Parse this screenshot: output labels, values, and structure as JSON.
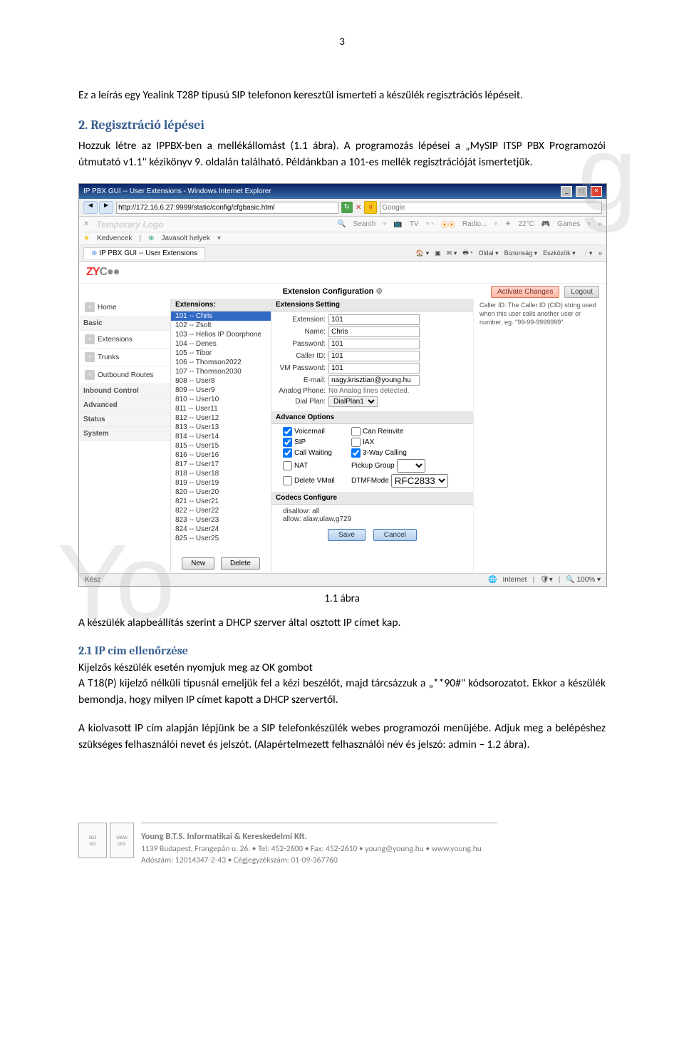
{
  "page_number": "3",
  "intro": "Ez a leírás egy Yealink T28P típusú SIP telefonon keresztül ismerteti a készülék regisztrációs lépéseit.",
  "section2_title": "2. Regisztráció lépései",
  "para2": "Hozzuk létre az IPPBX-ben a mellékállomást (1.1 ábra). A programozás lépései a „MySIP ITSP PBX Programozói útmutató v1.1\" kézikönyv 9. oldalán található. Példánkban a 101-es mellék regisztrációját ismertetjük.",
  "fig_caption": "1.1 ábra",
  "after_fig": "A készülék alapbeállítás szerint a DHCP szerver által osztott IP címet kap.",
  "section21_title": "2.1 IP cím ellenőrzése",
  "para21a": "Kijelzős készülék esetén nyomjuk meg az OK gombot",
  "para21b": "A T18(P) kijelző nélküli típusnál emeljük fel a kézi beszélőt, majd tárcsázzuk a „**90#\" kódsorozatot. Ekkor a készülék bemondja, hogy milyen IP címet kapott a DHCP szervertől.",
  "para21c": "A kiolvasott IP cím alapján lépjünk be a SIP telefonkészülék webes programozói menüjébe. Adjuk meg a belépéshez szükséges felhasználói nevet és jelszót. (Alapértelmezett felhasználói név és jelszó: admin – 1.2 ábra).",
  "screenshot": {
    "title": "IP PBX GUI -- User Extensions - Windows Internet Explorer",
    "url": "http://172.16.6.27:9999/static/config/cfgbasic.html",
    "search_placeholder": "Google",
    "toolbar": {
      "logo": "Temporary Logo",
      "search": "Search",
      "tv": "TV",
      "radio": "Radio...",
      "temp": "22°C",
      "games": "Games"
    },
    "favbar": {
      "label": "Kedvencek",
      "suggested": "Javasolt helyek"
    },
    "tab": "IP PBX GUI -- User Extensions",
    "tab_tools": {
      "home": "",
      "print": "",
      "page": "",
      "oldal": "Oldal",
      "biztonsag": "Biztonság",
      "eszkozok": "Eszközök"
    },
    "brand": "ZYCOO",
    "conf_title": "Extension Configuration",
    "btn_activate": "Activate Changes",
    "btn_logout": "Logout",
    "sidebar": [
      {
        "label": "Home",
        "icon": "home"
      },
      {
        "label": "Basic",
        "hdr": true
      },
      {
        "label": "Extensions",
        "icon": "ext"
      },
      {
        "label": "Trunks",
        "icon": "trk"
      },
      {
        "label": "Outbound Routes",
        "icon": "out"
      },
      {
        "label": "Inbound Control",
        "hdr": true
      },
      {
        "label": "Advanced",
        "hdr": true
      },
      {
        "label": "Status",
        "hdr": true
      },
      {
        "label": "System",
        "hdr": true
      }
    ],
    "extlist_hdr": "Extensions:",
    "extensions": [
      "101 -- Chris",
      "102 -- Zsolt",
      "103 -- Helios IP Doorphone",
      "104 -- Denes",
      "105 -- Tibor",
      "106 -- Thomson2022",
      "107 -- Thomson2030",
      "808 -- User8",
      "809 -- User9",
      "810 -- User10",
      "811 -- User11",
      "812 -- User12",
      "813 -- User13",
      "814 -- User14",
      "815 -- User15",
      "816 -- User16",
      "817 -- User17",
      "818 -- User18",
      "819 -- User19",
      "820 -- User20",
      "821 -- User21",
      "822 -- User22",
      "823 -- User23",
      "824 -- User24",
      "825 -- User25"
    ],
    "btn_new": "New",
    "btn_delete": "Delete",
    "settings_hdr": "Extensions Setting",
    "fields": {
      "extension_l": "Extension:",
      "extension_v": "101",
      "name_l": "Name:",
      "name_v": "Chris",
      "password_l": "Password:",
      "password_v": "101",
      "callerid_l": "Caller ID:",
      "callerid_v": "101",
      "vmpass_l": "VM Password:",
      "vmpass_v": "101",
      "email_l": "E-mail:",
      "email_v": "nagy.krisztian@young.hu",
      "analog_l": "Analog Phone:",
      "analog_v": "No Analog lines detected.",
      "dialplan_l": "Dial Plan:",
      "dialplan_v": "DialPlan1"
    },
    "advance_hdr": "Advance Options",
    "adv": {
      "voicemail": "Voicemail",
      "canreinvite": "Can Reinvite",
      "sip": "SIP",
      "iax": "IAX",
      "callwaiting": "Call Waiting",
      "threeway": "3-Way Calling",
      "nat": "NAT",
      "pickup": "Pickup Group",
      "deletevmail": "Delete VMail",
      "dtmf_l": "DTMFMode",
      "dtmf_v": "RFC2833"
    },
    "codecs_hdr": "Codecs Configure",
    "codecs_disallow": "disallow: all",
    "codecs_allow": "allow: alaw,ulaw,g729",
    "btn_save": "Save",
    "btn_cancel": "Cancel",
    "help_text": "Caller ID: The Caller ID (CID) string used when this user calls another user or number, eg. \"99-99-9999999\"",
    "status_left": "Kész",
    "status_internet": "Internet",
    "status_zoom": "100%"
  },
  "footer": {
    "name": "Young B.T.S. Informatikai & Kereskedelmi Kft.",
    "line1": "1139 Budapest, Frangepán u. 26.  •  Tel: 452-2600  •  Fax: 452-2610  •  young@young.hu  •  www.young.hu",
    "line2": "Adószám: 12014347-2-43  •  Cégjegyzékszám: 01-09-367760"
  }
}
